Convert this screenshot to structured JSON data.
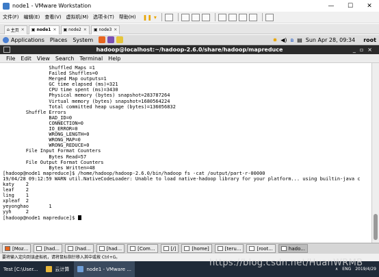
{
  "vm_window": {
    "title": "node1 - VMware Workstation",
    "controls": [
      "—",
      "☐",
      "✕"
    ]
  },
  "vm_menu": [
    "文件(F)",
    "编辑(E)",
    "查看(V)",
    "虚拟机(M)",
    "选项卡(T)",
    "帮助(H)"
  ],
  "vm_tabs": [
    {
      "label": "主页",
      "active": false
    },
    {
      "label": "node1",
      "active": true
    },
    {
      "label": "node2",
      "active": false
    },
    {
      "label": "node3",
      "active": false
    }
  ],
  "gnome_panel": {
    "menus": [
      "Applications",
      "Places",
      "System"
    ],
    "datetime": "Sun Apr 28, 09:34",
    "user": "root"
  },
  "terminal": {
    "title": "hadoop@localhost:~/hadoop-2.6.0/share/hadoop/mapreduce",
    "menu": [
      "File",
      "Edit",
      "View",
      "Search",
      "Terminal",
      "Help"
    ],
    "lines": [
      "                Shuffled Maps =1",
      "                Failed Shuffles=0",
      "                Merged Map outputs=1",
      "                GC time elapsed (ms)=321",
      "                CPU time spent (ms)=3430",
      "                Physical memory (bytes) snapshot=283787264",
      "                Virtual memory (bytes) snapshot=1680564224",
      "                Total committed heap usage (bytes)=136056832",
      "        Shuffle Errors",
      "                BAD_ID=0",
      "                CONNECTION=0",
      "                IO_ERROR=0",
      "                WRONG_LENGTH=0",
      "                WRONG_MAP=0",
      "                WRONG_REDUCE=0",
      "        File Input Format Counters",
      "                Bytes Read=57",
      "        File Output Format Counters",
      "                Bytes Written=48",
      "[hadoop@node1 mapreduce]$ /home/hadoop/hadoop-2.6.0/bin/hadoop fs -cat /output/part-r-00000",
      "19/04/28 09:12:59 WARN util.NativeCodeLoader: Unable to load native-hadoop library for your platform... using builtin-java c",
      "katy    2",
      "leaf    2",
      "ling    1",
      "xpleaf  2",
      "yeyonghao       1",
      "yyh     2"
    ],
    "prompt": "[hadoop@node1 mapreduce]$ "
  },
  "guest_taskbar": [
    {
      "label": "[Moz...",
      "active": false
    },
    {
      "label": "[had...",
      "active": false
    },
    {
      "label": "[had...",
      "active": false
    },
    {
      "label": "[had...",
      "active": false
    },
    {
      "label": "[Com...",
      "active": false
    },
    {
      "label": "[/]",
      "active": false
    },
    {
      "label": "[home]",
      "active": false
    },
    {
      "label": "[teru...",
      "active": false
    },
    {
      "label": "[root...",
      "active": false
    },
    {
      "label": "hado...",
      "active": true
    }
  ],
  "vm_status": "要将输入定向到该虚拟机，请将鼠标指针移入其中或按 Ctrl+G。",
  "windows_taskbar": {
    "items": [
      {
        "label": "Test [C:\\User...",
        "active": false
      },
      {
        "label": "云计算",
        "active": false
      },
      {
        "label": "node1 - VMware ...",
        "active": true
      }
    ],
    "lang": "ENG",
    "date": "2019/4/29"
  },
  "watermark": "https://blog.csdn.net/HuanWRMB",
  "colors": {
    "terminal_title_bg": "#2b2b2b",
    "vmware_pause": "#e8a400",
    "win_taskbar_bg": "#1f2a38"
  }
}
